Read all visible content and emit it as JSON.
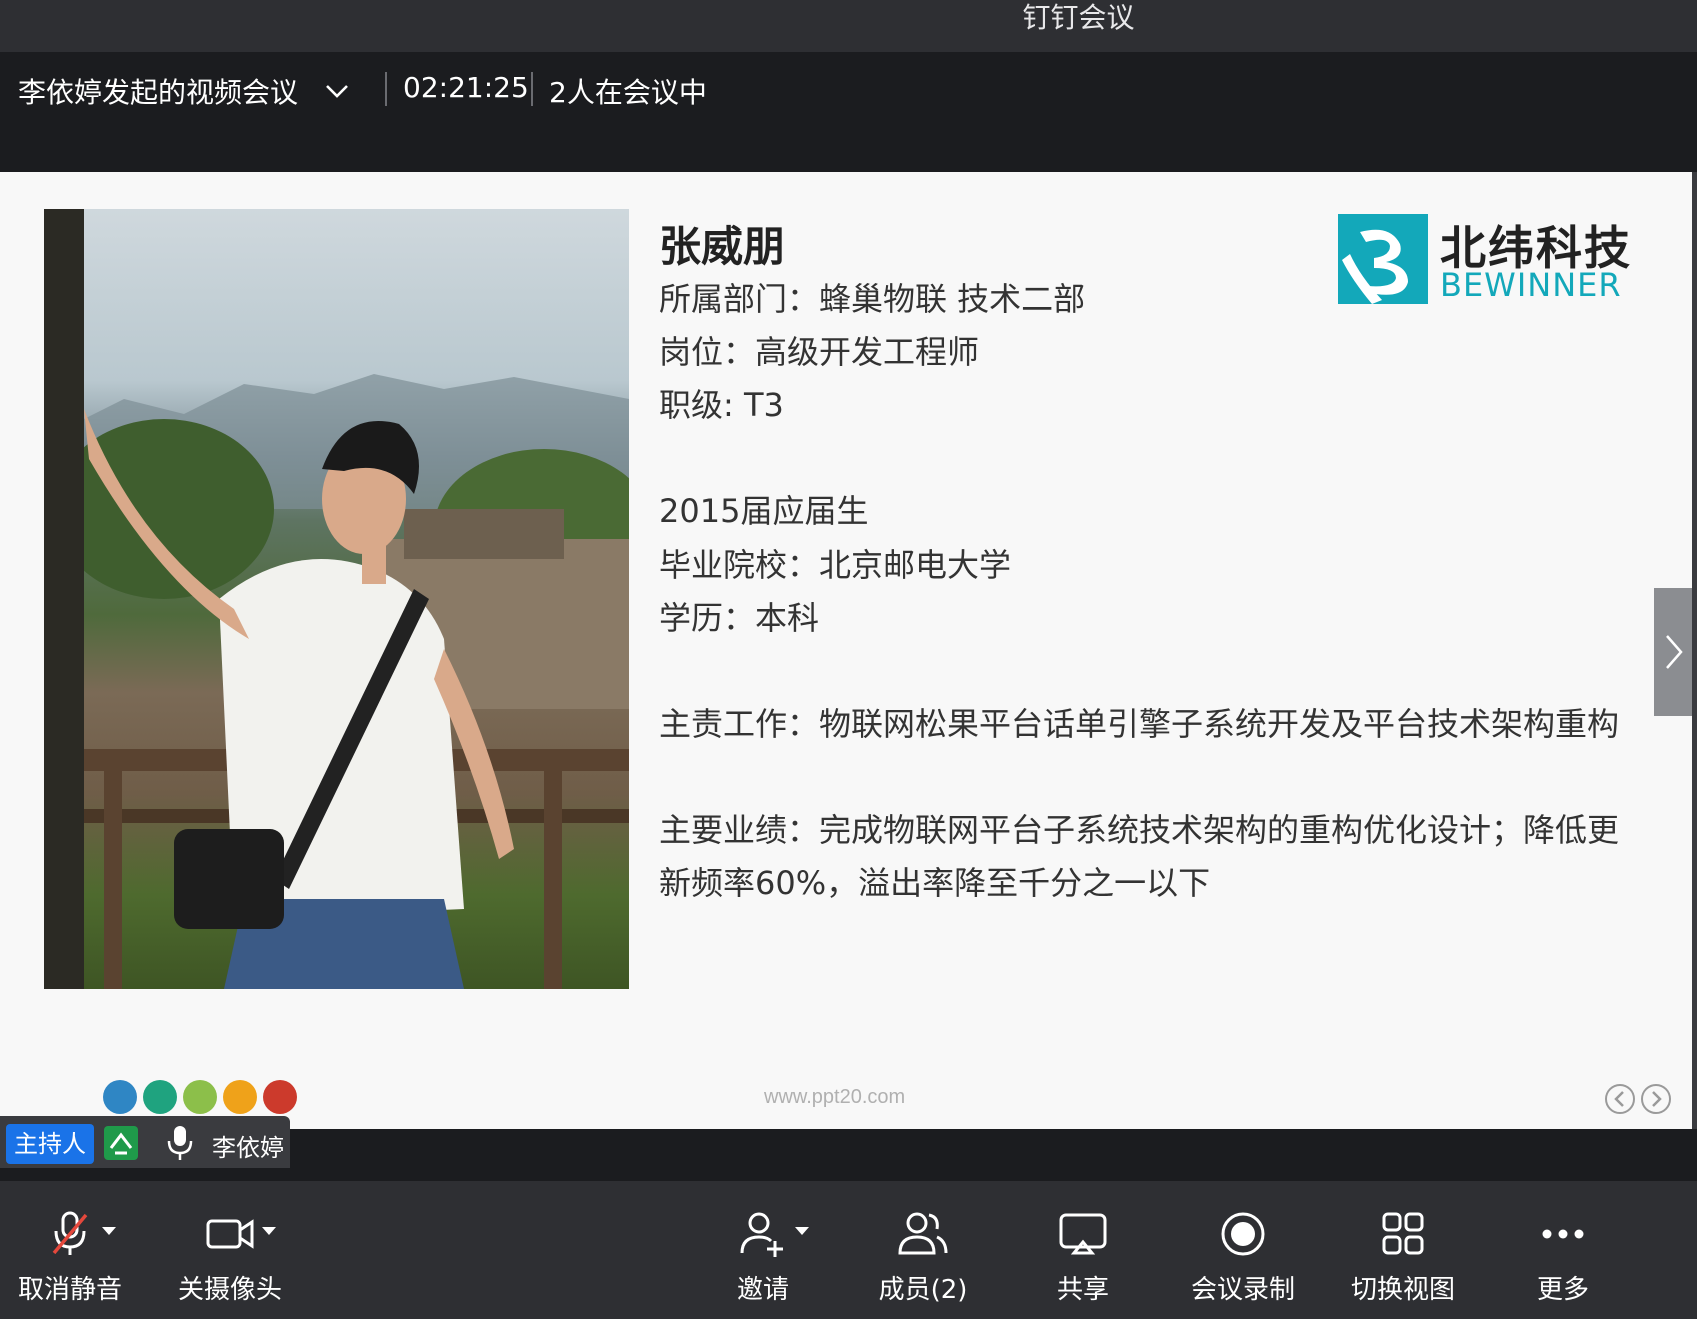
{
  "window": {
    "title": "钉钉会议"
  },
  "meeting": {
    "title": "李依婷发起的视频会议",
    "timer": "02:21:25",
    "participants": "2人在会议中"
  },
  "slide": {
    "name": "张威朋",
    "lines": [
      "所属部门：蜂巢物联 技术二部",
      "岗位：高级开发工程师",
      "职级: T3",
      "2015届应届生",
      "毕业院校：北京邮电大学",
      "学历：本科",
      "主责工作：物联网松果平台话单引擎子系统开发及平台技术架构重构",
      "主要业绩：完成物联网平台子系统技术架构的重构优化设计；降低更",
      "新频率60%，溢出率降至千分之一以下"
    ],
    "logo": {
      "cn": "北纬科技",
      "en": "BEWINNER",
      "color": "#13a8ba"
    },
    "watermark": "www.ppt20.com",
    "dot_colors": [
      "#2f86c4",
      "#1fa37f",
      "#8cbf4a",
      "#efa21a",
      "#cc3a2c"
    ]
  },
  "speaker": {
    "role_badge": "主持人",
    "name": "李依婷"
  },
  "toolbar": {
    "mute": "取消静音",
    "camera": "关摄像头",
    "invite": "邀请",
    "members": "成员(2)",
    "share": "共享",
    "record": "会议录制",
    "view": "切换视图",
    "more": "更多"
  },
  "colors": {
    "accent": "#1a73e8",
    "share_green": "#1f9a4a",
    "muted_red": "#e5483c"
  }
}
